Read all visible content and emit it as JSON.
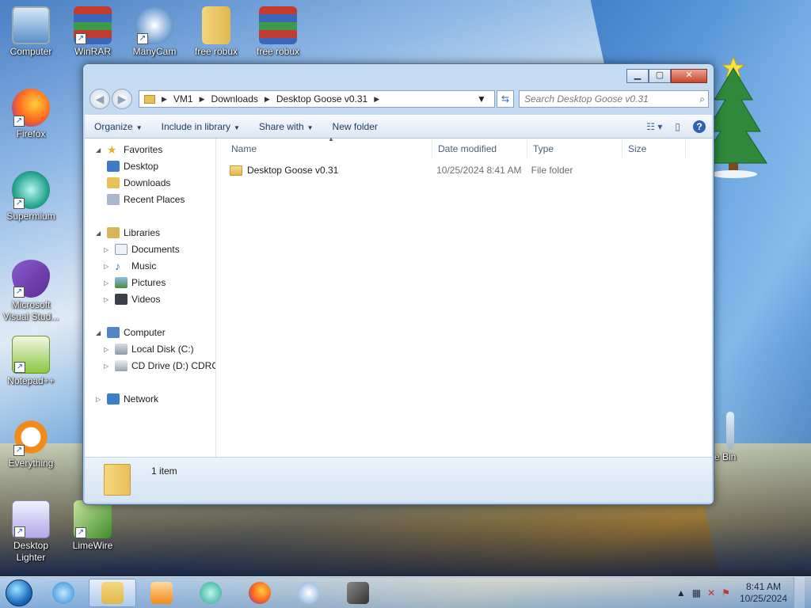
{
  "desktop": {
    "icons": [
      {
        "label": "Computer",
        "line2": ""
      },
      {
        "label": "WinRAR",
        "line2": ""
      },
      {
        "label": "ManyCam",
        "line2": ""
      },
      {
        "label": "free robux",
        "line2": ""
      },
      {
        "label": "free robux",
        "line2": ""
      },
      {
        "label": "Firefox",
        "line2": ""
      },
      {
        "label": "Supermium",
        "line2": ""
      },
      {
        "label": "Microsoft",
        "line2": "Visual Stud..."
      },
      {
        "label": "Notepad++",
        "line2": ""
      },
      {
        "label": "Everything",
        "line2": ""
      },
      {
        "label": "Desktop",
        "line2": "Lighter"
      },
      {
        "label": "LimeWire",
        "line2": ""
      }
    ],
    "partial_labels": {
      "recycle": "e Bin"
    }
  },
  "window": {
    "address": {
      "crumbs": [
        "VM1",
        "Downloads",
        "Desktop Goose v0.31"
      ]
    },
    "search": {
      "placeholder": "Search Desktop Goose v0.31"
    },
    "toolbar": {
      "organize": "Organize",
      "include": "Include in library",
      "share": "Share with",
      "new_folder": "New folder"
    },
    "nav": {
      "favorites": "Favorites",
      "desktop": "Desktop",
      "downloads": "Downloads",
      "recent": "Recent Places",
      "libraries": "Libraries",
      "documents": "Documents",
      "music": "Music",
      "pictures": "Pictures",
      "videos": "Videos",
      "computer": "Computer",
      "local_disk": "Local Disk (C:)",
      "cd_drive": "CD Drive (D:) CDROM",
      "network": "Network"
    },
    "columns": {
      "name": "Name",
      "date": "Date modified",
      "type": "Type",
      "size": "Size"
    },
    "files": [
      {
        "name": "Desktop Goose v0.31",
        "date": "10/25/2024 8:41 AM",
        "type": "File folder",
        "size": ""
      }
    ],
    "status": {
      "count": "1 item"
    }
  },
  "taskbar": {
    "clock_time": "8:41 AM",
    "clock_date": "10/25/2024"
  },
  "colors": {
    "accent": "#1d6fc1",
    "folder": "#e8c05a"
  }
}
